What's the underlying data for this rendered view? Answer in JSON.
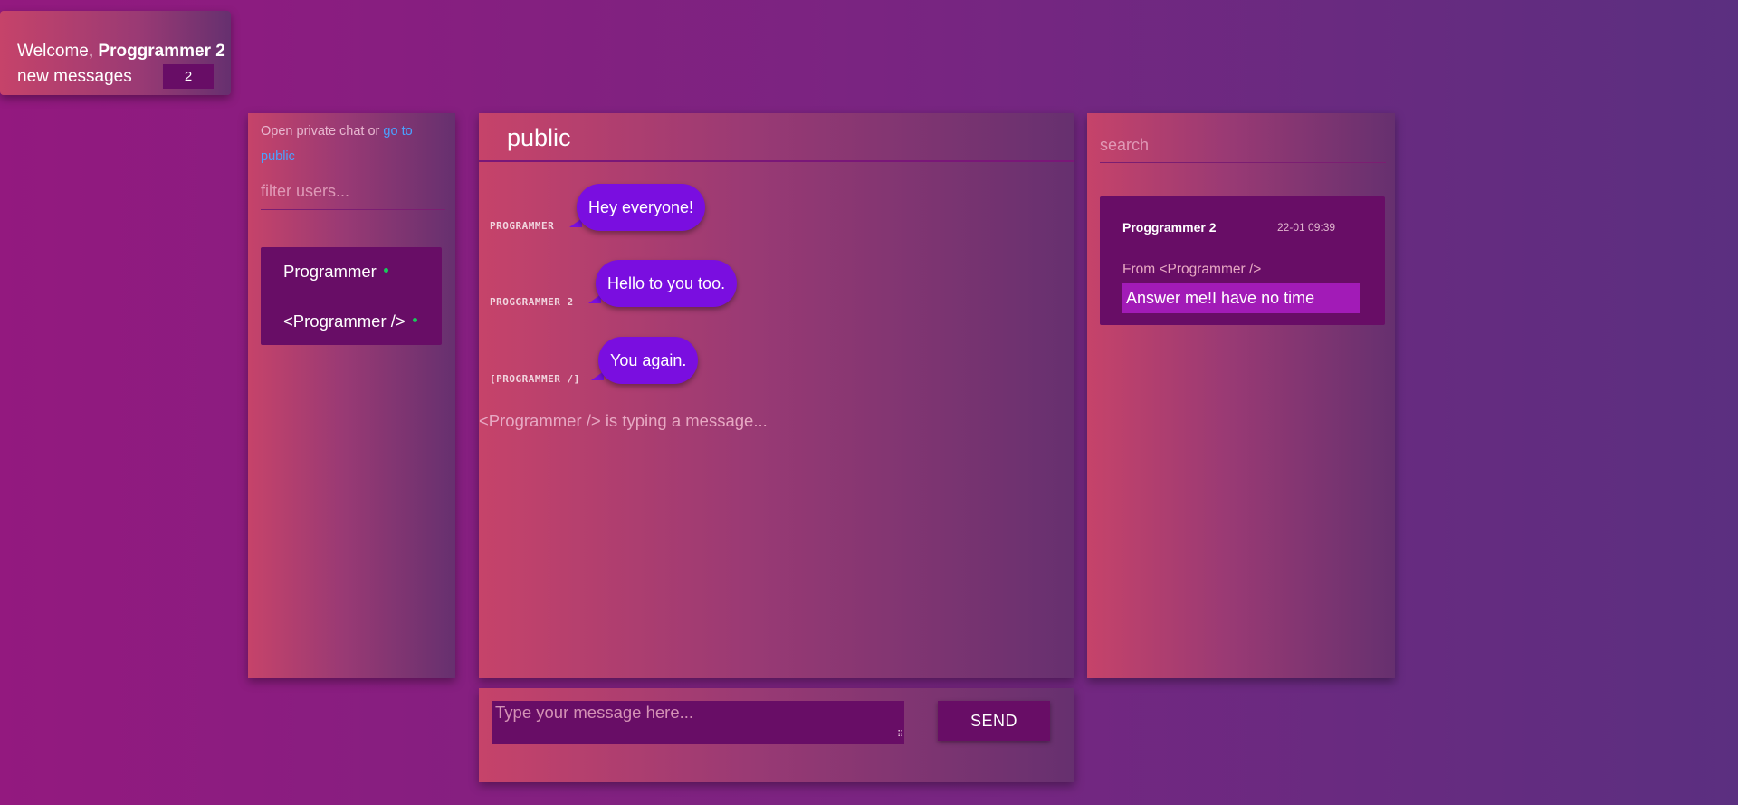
{
  "welcome": {
    "prefix": "Welcome,",
    "username": "Proggrammer 2",
    "new_messages_label": "new messages",
    "new_messages_count": "2"
  },
  "users_panel": {
    "hint_prefix": "Open private chat or ",
    "hint_link": "go to public",
    "filter_placeholder": "filter users...",
    "users": [
      {
        "name": "Programmer",
        "online": true
      },
      {
        "name": "<Programmer />",
        "online": true
      }
    ]
  },
  "chat": {
    "room": "public",
    "messages": [
      {
        "author": "Programmer",
        "text": "Hey everyone!"
      },
      {
        "author": "Proggrammer 2",
        "text": "Hello to you too."
      },
      {
        "author": "[Programmer /]",
        "text": "You again."
      }
    ],
    "typing": "<Programmer /> is typing a message..."
  },
  "composer": {
    "placeholder": "Type your message here...",
    "send_label": "SEND"
  },
  "notifications": {
    "search_placeholder": "search",
    "items": [
      {
        "name": "Proggrammer 2",
        "time": "22-01 09:39",
        "from": "From <Programmer />",
        "text": "Answer me!I have no time"
      }
    ]
  },
  "colors": {
    "accent_dark": "#680d66",
    "bubble": "#7a0ee0",
    "online_dot": "#19c95b",
    "link": "#4aa2ff"
  }
}
